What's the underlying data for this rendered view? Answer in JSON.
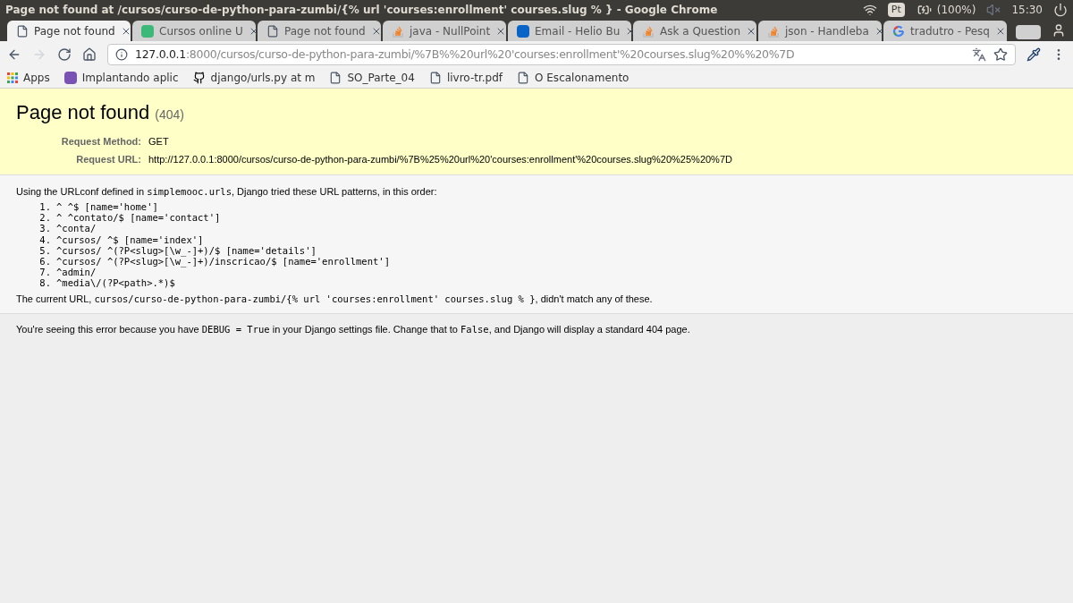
{
  "window": {
    "title": "Page not found at /cursos/curso-de-python-para-zumbi/{% url 'courses:enrollment' courses.slug % } - Google Chrome"
  },
  "system_tray": {
    "keyboard": "Pt",
    "battery": "(100%)",
    "clock": "15:30"
  },
  "tabs": [
    {
      "label": "Page not found",
      "kind": "page",
      "selected": true
    },
    {
      "label": "Cursos online U",
      "kind": "u",
      "selected": false
    },
    {
      "label": "Page not found",
      "kind": "page",
      "selected": false
    },
    {
      "label": "java - NullPoint",
      "kind": "stack",
      "selected": false
    },
    {
      "label": "Email - Helio Bu",
      "kind": "mail",
      "selected": false
    },
    {
      "label": "Ask a Question",
      "kind": "stack",
      "selected": false
    },
    {
      "label": "json - Handleba",
      "kind": "stack",
      "selected": false
    },
    {
      "label": "tradutro - Pesq",
      "kind": "google",
      "selected": false
    }
  ],
  "address_bar": {
    "host": "127.0.0.1",
    "rest": ":8000/cursos/curso-de-python-para-zumbi/%7B%%20url%20'courses:enrollment'%20courses.slug%20%%20%7D"
  },
  "bookmarks": [
    {
      "label": "Apps",
      "kind": "apps"
    },
    {
      "label": "Implantando aplic",
      "kind": "h"
    },
    {
      "label": "django/urls.py at m",
      "kind": "github"
    },
    {
      "label": "SO_Parte_04",
      "kind": "page"
    },
    {
      "label": "livro-tr.pdf",
      "kind": "page"
    },
    {
      "label": "O Escalonamento",
      "kind": "page"
    }
  ],
  "summary": {
    "title": "Page not found",
    "code": "(404)",
    "fields": [
      {
        "label": "Request Method:",
        "value": "GET"
      },
      {
        "label": "Request URL:",
        "value": "http://127.0.0.1:8000/cursos/curso-de-python-para-zumbi/%7B%25%20url%20'courses:enrollment'%20courses.slug%20%25%20%7D"
      }
    ]
  },
  "info": {
    "intro": [
      {
        "text": "Using the URLconf defined in ",
        "kind": "text"
      },
      {
        "text": "simplemooc.urls",
        "kind": "code"
      },
      {
        "text": ", Django tried these URL patterns, in this order:",
        "kind": "text"
      }
    ],
    "patterns": [
      {
        "number": "1.",
        "text": "^ ^$ [name='home']"
      },
      {
        "number": "2.",
        "text": "^ ^contato/$ [name='contact']"
      },
      {
        "number": "3.",
        "text": "^conta/"
      },
      {
        "number": "4.",
        "text": "^cursos/ ^$ [name='index']"
      },
      {
        "number": "5.",
        "text": "^cursos/ ^(?P<slug>[\\w_-]+)/$ [name='details']"
      },
      {
        "number": "6.",
        "text": "^cursos/ ^(?P<slug>[\\w_-]+)/inscricao/$ [name='enrollment']"
      },
      {
        "number": "7.",
        "text": "^admin/"
      },
      {
        "number": "8.",
        "text": "^media\\/(?P<path>.*)$"
      }
    ],
    "outro": [
      {
        "text": "The current URL, ",
        "kind": "text"
      },
      {
        "text": "cursos/curso-de-python-para-zumbi/{% url 'courses:enrollment' courses.slug % }",
        "kind": "code"
      },
      {
        "text": ", didn't match any of these.",
        "kind": "text"
      }
    ]
  },
  "explanation": [
    {
      "text": "You're seeing this error because you have ",
      "kind": "text"
    },
    {
      "text": "DEBUG = True",
      "kind": "code"
    },
    {
      "text": " in your Django settings file. Change that to ",
      "kind": "text"
    },
    {
      "text": "False",
      "kind": "code"
    },
    {
      "text": ", and Django will display a standard 404 page.",
      "kind": "text"
    }
  ]
}
